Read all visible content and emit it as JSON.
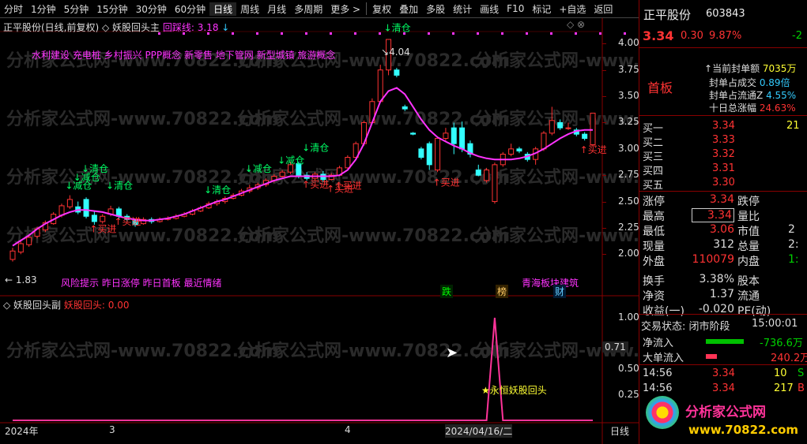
{
  "toolbar": [
    "分时",
    "1分钟",
    "5分钟",
    "15分钟",
    "30分钟",
    "60分钟",
    "日线",
    "周线",
    "月线",
    "多周期",
    "更多 >",
    "复权",
    "叠加",
    "多股",
    "统计",
    "画线",
    "F10",
    "标记",
    "+自选",
    "返回"
  ],
  "main_title": {
    "stock": "正平股份(日线,前复权)",
    "ind": "妖股回头主",
    "line": "回踩线: 3.18",
    "arrow": "↓"
  },
  "concepts": "水利建设 充电桩 乡村振兴 PPP概念 新零售 地下管网 新型城镇 旅游概念",
  "risk": "风险提示 昨日涨停 昨日首板 最近情绪",
  "sector": "青海板块建筑",
  "badges": {
    "die": "跌",
    "bang": "榜",
    "cai": "财"
  },
  "max_label": "4.04",
  "min_label": "← 1.83",
  "y_ticks": [
    "4.00",
    "3.75",
    "3.50",
    "3.25",
    "3.00",
    "2.75",
    "2.50",
    "2.25",
    "2.00"
  ],
  "sub_title": {
    "name": "妖股回头副",
    "ind": "妖股回头:",
    "val": "0.00"
  },
  "sub_ticks": [
    "1.00",
    "0.71",
    "0.50",
    "0.25"
  ],
  "sub_label": "永恒妖股回头",
  "x_labels": [
    "2024年",
    "3",
    "4",
    "2024/04/16/二",
    "日线"
  ],
  "quote": {
    "name": "正平股份",
    "code": "603843",
    "price": "3.34",
    "chg": "0.30",
    "pct": "9.87%",
    "ext": "-2",
    "board": "首板",
    "seal_label": "当前封单额",
    "seal_val": "7035万",
    "seal_turn_label": "封单占成交",
    "seal_turn_val": "0.89倍",
    "seal_float_label": "封单占流通Z",
    "seal_float_val": "4.55%",
    "ten_label": "十日总涨幅",
    "ten_val": "24.63%"
  },
  "book": [
    {
      "l": "买一",
      "p": "3.34",
      "v": "21"
    },
    {
      "l": "买二",
      "p": "3.33",
      "v": ""
    },
    {
      "l": "买三",
      "p": "3.32",
      "v": ""
    },
    {
      "l": "买四",
      "p": "3.31",
      "v": ""
    },
    {
      "l": "买五",
      "p": "3.30",
      "v": ""
    }
  ],
  "stats": [
    {
      "a": "涨停",
      "b": "3.34",
      "c": "跌停",
      "d": ""
    },
    {
      "a": "最高",
      "b": "3.34",
      "c": "量比",
      "d": ""
    },
    {
      "a": "最低",
      "b": "3.06",
      "c": "市值",
      "d": "2"
    },
    {
      "a": "现量",
      "b": "312",
      "c": "总量",
      "d": "2:"
    },
    {
      "a": "外盘",
      "b": "110079",
      "c": "内盘",
      "d": "1:"
    },
    {
      "a": "换手",
      "b": "3.38%",
      "c": "股本",
      "d": ""
    },
    {
      "a": "净资",
      "b": "1.37",
      "c": "流通",
      "d": ""
    },
    {
      "a": "收益(一)",
      "b": "-0.020",
      "c": "PE(动)",
      "d": ""
    }
  ],
  "trade_label": "交易状态: 闭市阶段",
  "trade_time": "15:00:01",
  "net_in": {
    "label": "净流入",
    "val": "-736.6万"
  },
  "big_in": {
    "label": "大单流入",
    "val": "240.2万"
  },
  "ticks": [
    {
      "t": "14:56",
      "p": "3.34",
      "v": "10",
      "s": "S"
    },
    {
      "t": "14:56",
      "p": "3.34",
      "v": "217",
      "s": "B"
    },
    {
      "t": "14:56",
      "p": "3.34",
      "v": "",
      "s": ""
    }
  ],
  "logo": {
    "text": "分析家公式网",
    "url": "www.70822.com"
  },
  "watermark": "分析家公式网-www.70822.com",
  "chart_data": {
    "type": "candlestick",
    "ylim": [
      1.83,
      4.1
    ],
    "candles": [
      [
        1.95,
        2.03,
        2.06,
        1.93
      ],
      [
        2.02,
        2.1,
        2.12,
        2.0
      ],
      [
        2.09,
        2.16,
        2.18,
        2.07
      ],
      [
        2.17,
        2.24,
        2.26,
        2.15
      ],
      [
        2.23,
        2.3,
        2.32,
        2.21
      ],
      [
        2.29,
        2.38,
        2.4,
        2.28
      ],
      [
        2.37,
        2.46,
        2.48,
        2.35
      ],
      [
        2.45,
        2.52,
        2.56,
        2.43
      ],
      [
        2.45,
        2.4,
        2.5,
        2.38
      ],
      [
        2.52,
        2.36,
        2.54,
        2.34
      ],
      [
        2.37,
        2.31,
        2.41,
        2.28
      ],
      [
        2.31,
        2.36,
        2.38,
        2.29
      ],
      [
        2.38,
        2.43,
        2.46,
        2.36
      ],
      [
        2.43,
        2.36,
        2.45,
        2.33
      ],
      [
        2.36,
        2.33,
        2.38,
        2.31
      ],
      [
        2.32,
        2.28,
        2.34,
        2.26
      ],
      [
        2.29,
        2.33,
        2.35,
        2.28
      ],
      [
        2.33,
        2.31,
        2.35,
        2.29
      ],
      [
        2.31,
        2.33,
        2.35,
        2.3
      ],
      [
        2.33,
        2.34,
        2.36,
        2.32
      ],
      [
        2.34,
        2.36,
        2.38,
        2.33
      ],
      [
        2.36,
        2.38,
        2.4,
        2.35
      ],
      [
        2.38,
        2.41,
        2.43,
        2.37
      ],
      [
        2.41,
        2.44,
        2.46,
        2.4
      ],
      [
        2.44,
        2.48,
        2.5,
        2.43
      ],
      [
        2.48,
        2.5,
        2.52,
        2.46
      ],
      [
        2.5,
        2.53,
        2.55,
        2.48
      ],
      [
        2.53,
        2.56,
        2.58,
        2.52
      ],
      [
        2.56,
        2.6,
        2.62,
        2.55
      ],
      [
        2.6,
        2.63,
        2.66,
        2.58
      ],
      [
        2.63,
        2.66,
        2.68,
        2.61
      ],
      [
        2.66,
        2.7,
        2.72,
        2.64
      ],
      [
        2.7,
        2.74,
        2.76,
        2.68
      ],
      [
        2.74,
        2.78,
        2.8,
        2.73
      ],
      [
        2.78,
        2.85,
        2.88,
        2.76
      ],
      [
        2.86,
        2.75,
        2.88,
        2.72
      ],
      [
        2.75,
        2.72,
        2.78,
        2.7
      ],
      [
        2.72,
        2.76,
        2.78,
        2.7
      ],
      [
        2.76,
        2.71,
        2.79,
        2.69
      ],
      [
        2.71,
        2.75,
        2.77,
        2.7
      ],
      [
        2.75,
        2.82,
        2.84,
        2.74
      ],
      [
        2.82,
        2.92,
        2.94,
        2.81
      ],
      [
        2.92,
        3.05,
        3.07,
        2.91
      ],
      [
        3.05,
        3.25,
        3.27,
        3.03
      ],
      [
        3.25,
        3.45,
        3.48,
        3.24
      ],
      [
        3.45,
        3.75,
        3.8,
        3.44
      ],
      [
        3.75,
        4.04,
        4.04,
        3.7
      ],
      [
        3.75,
        3.7,
        3.77,
        3.68
      ],
      [
        3.4,
        3.38,
        3.42,
        3.36
      ],
      [
        3.15,
        3.14,
        3.16,
        3.13
      ],
      [
        3.0,
        2.92,
        3.02,
        2.9
      ],
      [
        3.05,
        2.85,
        3.07,
        2.8
      ],
      [
        2.8,
        3.1,
        3.12,
        2.78
      ],
      [
        3.1,
        3.15,
        3.2,
        3.08
      ],
      [
        3.2,
        3.05,
        3.25,
        2.95
      ],
      [
        3.2,
        3.0,
        3.26,
        2.97
      ],
      [
        3.05,
        2.95,
        3.08,
        2.92
      ],
      [
        2.8,
        2.75,
        2.85,
        2.74
      ],
      [
        2.7,
        2.8,
        2.82,
        2.68
      ],
      [
        2.5,
        2.85,
        2.87,
        2.48
      ],
      [
        2.85,
        2.95,
        2.97,
        2.83
      ],
      [
        2.95,
        3.0,
        3.05,
        2.93
      ],
      [
        3.0,
        2.98,
        3.02,
        2.96
      ],
      [
        2.95,
        2.9,
        2.97,
        2.88
      ],
      [
        2.9,
        3.0,
        3.02,
        2.85
      ],
      [
        3.0,
        3.15,
        3.17,
        2.98
      ],
      [
        3.15,
        3.27,
        3.4,
        3.13
      ],
      [
        3.25,
        3.2,
        3.28,
        3.18
      ],
      [
        3.2,
        3.2,
        3.25,
        3.18
      ],
      [
        3.18,
        3.14,
        3.2,
        3.12
      ],
      [
        3.14,
        3.1,
        3.16,
        3.08
      ],
      [
        3.04,
        3.34,
        3.34,
        3.03
      ]
    ],
    "ma": [
      2.08,
      2.13,
      2.18,
      2.24,
      2.29,
      2.33,
      2.37,
      2.4,
      2.42,
      2.42,
      2.41,
      2.4,
      2.38,
      2.36,
      2.34,
      2.33,
      2.32,
      2.32,
      2.33,
      2.34,
      2.36,
      2.38,
      2.41,
      2.44,
      2.47,
      2.5,
      2.52,
      2.55,
      2.58,
      2.61,
      2.64,
      2.67,
      2.7,
      2.72,
      2.74,
      2.74,
      2.74,
      2.74,
      2.74,
      2.74,
      2.75,
      2.8,
      2.9,
      3.05,
      3.25,
      3.45,
      3.55,
      3.58,
      3.52,
      3.4,
      3.28,
      3.18,
      3.11,
      3.07,
      3.03,
      3.0,
      2.96,
      2.93,
      2.91,
      2.9,
      2.9,
      2.9,
      2.91,
      2.93,
      2.96,
      3.0,
      3.05,
      3.1,
      3.14,
      3.17,
      3.18,
      3.18
    ],
    "sub": {
      "ylim": [
        0,
        1.1
      ],
      "values": [
        0,
        0,
        0,
        0,
        0,
        0,
        0,
        0,
        0,
        0,
        0,
        0,
        0,
        0,
        0,
        0,
        0,
        0,
        0,
        0,
        0,
        0,
        0,
        0,
        0,
        0,
        0,
        0,
        0,
        0,
        0,
        0,
        0,
        0,
        0,
        0,
        0,
        0,
        0,
        0,
        0,
        0,
        0,
        0,
        0,
        0,
        0,
        0,
        0,
        0,
        0,
        0,
        0,
        0,
        0,
        0,
        0,
        0,
        0,
        1.0,
        0,
        0,
        0,
        0,
        0,
        0,
        0,
        0,
        0,
        0,
        0,
        0
      ]
    }
  }
}
